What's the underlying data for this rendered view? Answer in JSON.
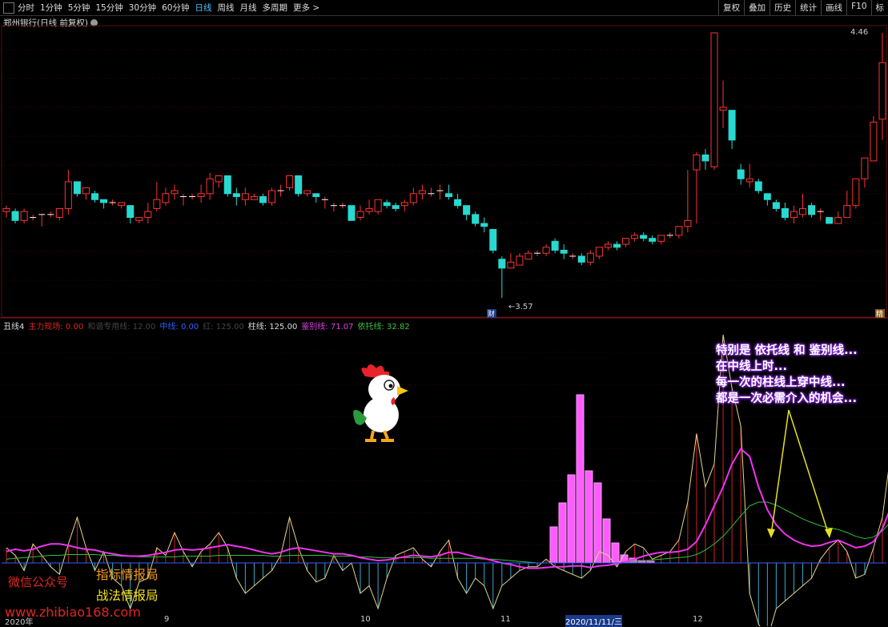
{
  "toolbar": {
    "items": [
      "分时",
      "1分钟",
      "5分钟",
      "15分钟",
      "30分钟",
      "60分钟",
      "日线",
      "周线",
      "月线",
      "多周期",
      "更多 >"
    ],
    "active_index": 6,
    "right_buttons": [
      "复权",
      "叠加",
      "历史",
      "统计",
      "画线",
      "F10",
      "标"
    ]
  },
  "stock_title": "郑州银行(日线 前复权)",
  "price_labels": {
    "high": "4.46",
    "low": "3.57"
  },
  "markers": {
    "cai": "财",
    "jing": "精"
  },
  "indicator_bar": [
    {
      "text": "丑线4",
      "color": "#dddddd"
    },
    {
      "text": "主力现场: 0.00",
      "color": "#e0261f"
    },
    {
      "text": "和谐专用线: 12.00",
      "color": "#444444"
    },
    {
      "text": "中线: 0.00",
      "color": "#3060ff"
    },
    {
      "text": "红: 125.00",
      "color": "#444444"
    },
    {
      "text": "柱线: 125.00",
      "color": "#dddddd"
    },
    {
      "text": "鉴别线: 71.07",
      "color": "#e040e0"
    },
    {
      "text": "依托线: 32.82",
      "color": "#40c040"
    }
  ],
  "annotation": [
    "特别是 依托线 和 鉴别线...",
    "在中线上时...",
    "每一次的柱线上穿中线...",
    "都是一次必需介入的机会..."
  ],
  "watermarks": {
    "wechat": "微信公众号",
    "brand1": "指标情报局",
    "brand2": "战法情报局",
    "url": "www.zhibiao168.com"
  },
  "x_axis": [
    "2020年",
    "9",
    "10",
    "11",
    "2020/11/11/三",
    "12"
  ],
  "chart_data": {
    "type": "candlestick",
    "high_label": 4.46,
    "low_label": 3.57,
    "candles": [
      {
        "o": 3.86,
        "h": 3.88,
        "c": 3.87,
        "l": 3.84
      },
      {
        "o": 3.86,
        "h": 3.87,
        "c": 3.83,
        "l": 3.82
      },
      {
        "o": 3.83,
        "h": 3.87,
        "c": 3.86,
        "l": 3.82
      },
      {
        "o": 3.84,
        "h": 3.85,
        "c": 3.84,
        "l": 3.83
      },
      {
        "o": 3.85,
        "h": 3.85,
        "c": 3.85,
        "l": 3.81
      },
      {
        "o": 3.85,
        "h": 3.86,
        "c": 3.85,
        "l": 3.84
      },
      {
        "o": 3.84,
        "h": 3.87,
        "c": 3.87,
        "l": 3.83
      },
      {
        "o": 3.87,
        "h": 4.0,
        "c": 3.96,
        "l": 3.85
      },
      {
        "o": 3.96,
        "h": 3.96,
        "c": 3.92,
        "l": 3.91
      },
      {
        "o": 3.92,
        "h": 3.94,
        "c": 3.94,
        "l": 3.9
      },
      {
        "o": 3.92,
        "h": 3.93,
        "c": 3.9,
        "l": 3.89
      },
      {
        "o": 3.9,
        "h": 3.9,
        "c": 3.89,
        "l": 3.87
      },
      {
        "o": 3.89,
        "h": 3.9,
        "c": 3.89,
        "l": 3.88
      },
      {
        "o": 3.88,
        "h": 3.88,
        "c": 3.89,
        "l": 3.87
      },
      {
        "o": 3.88,
        "h": 3.88,
        "c": 3.84,
        "l": 3.82
      },
      {
        "o": 3.83,
        "h": 3.84,
        "c": 3.84,
        "l": 3.82
      },
      {
        "o": 3.84,
        "h": 3.89,
        "c": 3.86,
        "l": 3.82
      },
      {
        "o": 3.87,
        "h": 3.96,
        "c": 3.9,
        "l": 3.86
      },
      {
        "o": 3.89,
        "h": 3.94,
        "c": 3.92,
        "l": 3.88
      },
      {
        "o": 3.92,
        "h": 3.95,
        "c": 3.93,
        "l": 3.9
      },
      {
        "o": 3.91,
        "h": 3.92,
        "c": 3.91,
        "l": 3.88
      },
      {
        "o": 3.91,
        "h": 3.92,
        "c": 3.91,
        "l": 3.9
      },
      {
        "o": 3.91,
        "h": 3.95,
        "c": 3.92,
        "l": 3.89
      },
      {
        "o": 3.92,
        "h": 3.99,
        "c": 3.97,
        "l": 3.9
      },
      {
        "o": 3.96,
        "h": 3.98,
        "c": 3.98,
        "l": 3.94
      },
      {
        "o": 3.98,
        "h": 3.98,
        "c": 3.92,
        "l": 3.91
      },
      {
        "o": 3.92,
        "h": 3.94,
        "c": 3.91,
        "l": 3.88
      },
      {
        "o": 3.9,
        "h": 3.94,
        "c": 3.92,
        "l": 3.88
      },
      {
        "o": 3.9,
        "h": 3.92,
        "c": 3.91,
        "l": 3.9
      },
      {
        "o": 3.91,
        "h": 3.92,
        "c": 3.89,
        "l": 3.88
      },
      {
        "o": 3.89,
        "h": 3.94,
        "c": 3.93,
        "l": 3.88
      },
      {
        "o": 3.93,
        "h": 3.95,
        "c": 3.93,
        "l": 3.91
      },
      {
        "o": 3.94,
        "h": 3.98,
        "c": 3.98,
        "l": 3.93
      },
      {
        "o": 3.98,
        "h": 3.98,
        "c": 3.92,
        "l": 3.91
      },
      {
        "o": 3.92,
        "h": 3.93,
        "c": 3.93,
        "l": 3.91
      },
      {
        "o": 3.92,
        "h": 3.92,
        "c": 3.91,
        "l": 3.89
      },
      {
        "o": 3.9,
        "h": 3.91,
        "c": 3.9,
        "l": 3.87
      },
      {
        "o": 3.88,
        "h": 3.89,
        "c": 3.88,
        "l": 3.86
      },
      {
        "o": 3.88,
        "h": 3.89,
        "c": 3.88,
        "l": 3.87
      },
      {
        "o": 3.88,
        "h": 3.88,
        "c": 3.83,
        "l": 3.83
      },
      {
        "o": 3.84,
        "h": 3.88,
        "c": 3.86,
        "l": 3.83
      },
      {
        "o": 3.86,
        "h": 3.9,
        "c": 3.87,
        "l": 3.85
      },
      {
        "o": 3.86,
        "h": 3.9,
        "c": 3.9,
        "l": 3.85
      },
      {
        "o": 3.89,
        "h": 3.9,
        "c": 3.88,
        "l": 3.87
      },
      {
        "o": 3.88,
        "h": 3.89,
        "c": 3.87,
        "l": 3.86
      },
      {
        "o": 3.88,
        "h": 3.9,
        "c": 3.89,
        "l": 3.86
      },
      {
        "o": 3.89,
        "h": 3.94,
        "c": 3.92,
        "l": 3.88
      },
      {
        "o": 3.92,
        "h": 3.95,
        "c": 3.93,
        "l": 3.9
      },
      {
        "o": 3.92,
        "h": 3.94,
        "c": 3.92,
        "l": 3.91
      },
      {
        "o": 3.93,
        "h": 3.95,
        "c": 3.93,
        "l": 3.9
      },
      {
        "o": 3.92,
        "h": 3.95,
        "c": 3.91,
        "l": 3.9
      },
      {
        "o": 3.9,
        "h": 3.92,
        "c": 3.88,
        "l": 3.87
      },
      {
        "o": 3.88,
        "h": 3.88,
        "c": 3.85,
        "l": 3.83
      },
      {
        "o": 3.85,
        "h": 3.86,
        "c": 3.82,
        "l": 3.81
      },
      {
        "o": 3.82,
        "h": 3.84,
        "c": 3.81,
        "l": 3.79
      },
      {
        "o": 3.8,
        "h": 3.8,
        "c": 3.73,
        "l": 3.72
      },
      {
        "o": 3.7,
        "h": 3.71,
        "c": 3.67,
        "l": 3.57
      },
      {
        "o": 3.67,
        "h": 3.72,
        "c": 3.69,
        "l": 3.67
      },
      {
        "o": 3.68,
        "h": 3.72,
        "c": 3.71,
        "l": 3.69
      },
      {
        "o": 3.7,
        "h": 3.73,
        "c": 3.72,
        "l": 3.7
      },
      {
        "o": 3.72,
        "h": 3.73,
        "c": 3.72,
        "l": 3.71
      },
      {
        "o": 3.72,
        "h": 3.75,
        "c": 3.74,
        "l": 3.71
      },
      {
        "o": 3.76,
        "h": 3.77,
        "c": 3.73,
        "l": 3.72
      },
      {
        "o": 3.73,
        "h": 3.75,
        "c": 3.72,
        "l": 3.7
      },
      {
        "o": 3.71,
        "h": 3.72,
        "c": 3.71,
        "l": 3.7
      },
      {
        "o": 3.71,
        "h": 3.72,
        "c": 3.69,
        "l": 3.68
      },
      {
        "o": 3.69,
        "h": 3.73,
        "c": 3.72,
        "l": 3.68
      },
      {
        "o": 3.71,
        "h": 3.74,
        "c": 3.74,
        "l": 3.7
      },
      {
        "o": 3.74,
        "h": 3.76,
        "c": 3.75,
        "l": 3.73
      },
      {
        "o": 3.75,
        "h": 3.76,
        "c": 3.74,
        "l": 3.73
      },
      {
        "o": 3.75,
        "h": 3.77,
        "c": 3.77,
        "l": 3.74
      },
      {
        "o": 3.77,
        "h": 3.79,
        "c": 3.78,
        "l": 3.76
      },
      {
        "o": 3.78,
        "h": 3.79,
        "c": 3.77,
        "l": 3.76
      },
      {
        "o": 3.77,
        "h": 3.78,
        "c": 3.76,
        "l": 3.75
      },
      {
        "o": 3.76,
        "h": 3.78,
        "c": 3.78,
        "l": 3.75
      },
      {
        "o": 3.78,
        "h": 3.79,
        "c": 3.78,
        "l": 3.77
      },
      {
        "o": 3.78,
        "h": 3.81,
        "c": 3.81,
        "l": 3.77
      },
      {
        "o": 3.81,
        "h": 4.0,
        "c": 3.83,
        "l": 3.79
      },
      {
        "o": 4.0,
        "h": 4.06,
        "c": 4.05,
        "l": 3.82
      },
      {
        "o": 4.05,
        "h": 4.07,
        "c": 4.03,
        "l": 4.0
      },
      {
        "o": 4.01,
        "h": 4.44,
        "c": 4.46,
        "l": 4.0
      },
      {
        "o": 4.2,
        "h": 4.3,
        "c": 4.21,
        "l": 4.14
      },
      {
        "o": 4.2,
        "h": 4.2,
        "c": 4.1,
        "l": 4.07
      },
      {
        "o": 4.0,
        "h": 4.02,
        "c": 3.97,
        "l": 3.95
      },
      {
        "o": 3.96,
        "h": 4.02,
        "c": 3.97,
        "l": 3.94
      },
      {
        "o": 3.96,
        "h": 3.97,
        "c": 3.93,
        "l": 3.92
      },
      {
        "o": 3.92,
        "h": 3.92,
        "c": 3.9,
        "l": 3.88
      },
      {
        "o": 3.89,
        "h": 3.9,
        "c": 3.87,
        "l": 3.86
      },
      {
        "o": 3.87,
        "h": 3.89,
        "c": 3.84,
        "l": 3.83
      },
      {
        "o": 3.84,
        "h": 3.88,
        "c": 3.86,
        "l": 3.82
      },
      {
        "o": 3.85,
        "h": 3.92,
        "c": 3.87,
        "l": 3.84
      },
      {
        "o": 3.88,
        "h": 3.89,
        "c": 3.85,
        "l": 3.84
      },
      {
        "o": 3.86,
        "h": 3.87,
        "c": 3.86,
        "l": 3.83
      },
      {
        "o": 3.84,
        "h": 3.84,
        "c": 3.82,
        "l": 3.82
      },
      {
        "o": 3.82,
        "h": 3.86,
        "c": 3.84,
        "l": 3.82
      },
      {
        "o": 3.84,
        "h": 3.93,
        "c": 3.88,
        "l": 3.84
      },
      {
        "o": 3.88,
        "h": 3.96,
        "c": 3.97,
        "l": 3.87
      },
      {
        "o": 3.97,
        "h": 4.04,
        "c": 4.04,
        "l": 3.94
      },
      {
        "o": 4.03,
        "h": 4.18,
        "c": 4.16,
        "l": 4.03
      },
      {
        "o": 4.17,
        "h": 4.46,
        "c": 4.36,
        "l": 4.1
      }
    ],
    "indicator": {
      "zhuxian": [
        20,
        10,
        -10,
        25,
        10,
        -5,
        -15,
        25,
        60,
        20,
        -10,
        15,
        -20,
        -30,
        -60,
        -25,
        -20,
        20,
        10,
        40,
        15,
        -5,
        15,
        25,
        40,
        20,
        -20,
        -40,
        -30,
        -20,
        -10,
        10,
        60,
        20,
        -10,
        -25,
        -20,
        10,
        -10,
        0,
        -40,
        -30,
        -60,
        -20,
        10,
        15,
        20,
        5,
        -5,
        15,
        30,
        -20,
        -40,
        -20,
        -30,
        -60,
        -30,
        -20,
        -10,
        -5,
        -5,
        5,
        -5,
        -10,
        -15,
        -20,
        -10,
        15,
        10,
        -5,
        15,
        25,
        20,
        5,
        10,
        15,
        30,
        80,
        170,
        100,
        130,
        300,
        230,
        180,
        -40,
        -80,
        -100,
        -60,
        -50,
        -40,
        -30,
        -20,
        5,
        20,
        30,
        15,
        -20,
        -15,
        20,
        60,
        150,
        200,
        280
      ],
      "jianbie": [
        15,
        18,
        16,
        18,
        22,
        25,
        25,
        23,
        20,
        18,
        17,
        14,
        12,
        10,
        9,
        9,
        10,
        12,
        14,
        17,
        18,
        17,
        18,
        20,
        22,
        24,
        22,
        20,
        17,
        14,
        12,
        14,
        18,
        20,
        18,
        16,
        14,
        12,
        12,
        10,
        7,
        5,
        3,
        4,
        6,
        8,
        10,
        9,
        8,
        10,
        14,
        14,
        11,
        8,
        6,
        3,
        0,
        -2,
        -5,
        -7,
        -7,
        -6,
        -5,
        -5,
        -4,
        -4,
        -6,
        -4,
        -3,
        -1,
        2,
        5,
        9,
        12,
        14,
        14,
        15,
        18,
        28,
        50,
        75,
        100,
        130,
        150,
        140,
        100,
        70,
        50,
        38,
        30,
        25,
        22,
        23,
        27,
        30,
        25,
        20,
        22,
        28,
        45,
        75,
        110,
        155
      ],
      "yituo": [
        5,
        6,
        7,
        8,
        9,
        10,
        10,
        11,
        11,
        11,
        11,
        10,
        10,
        9,
        9,
        8,
        8,
        8,
        8,
        8,
        9,
        9,
        9,
        9,
        10,
        10,
        10,
        10,
        10,
        10,
        9,
        9,
        10,
        10,
        10,
        10,
        10,
        9,
        9,
        9,
        8,
        8,
        7,
        7,
        7,
        7,
        7,
        7,
        6,
        6,
        6,
        6,
        6,
        6,
        5,
        5,
        4,
        3,
        2,
        1,
        0,
        0,
        0,
        0,
        0,
        0,
        0,
        0,
        0,
        0,
        1,
        2,
        3,
        4,
        5,
        6,
        7,
        8,
        11,
        17,
        25,
        35,
        48,
        62,
        75,
        80,
        80,
        76,
        70,
        64,
        58,
        53,
        49,
        46,
        44,
        40,
        35,
        32,
        34,
        42,
        55,
        70,
        92
      ],
      "magenta_bars": [
        0,
        0,
        0,
        0,
        0,
        0,
        0,
        0,
        0,
        0,
        0,
        0,
        0,
        0,
        0,
        0,
        0,
        0,
        0,
        0,
        0,
        0,
        0,
        0,
        0,
        0,
        0,
        0,
        0,
        0,
        0,
        0,
        0,
        0,
        0,
        0,
        0,
        0,
        0,
        0,
        0,
        0,
        0,
        0,
        0,
        0,
        0,
        0,
        0,
        0,
        0,
        0,
        0,
        0,
        0,
        0,
        0,
        0,
        0,
        0,
        0,
        0,
        0,
        0,
        0,
        0,
        0,
        0,
        0,
        0,
        0,
        0,
        0,
        0,
        0,
        0,
        0,
        0,
        0,
        0,
        0,
        0,
        0,
        0,
        0,
        0,
        0,
        0,
        0,
        0,
        0,
        0,
        0,
        0,
        0,
        0,
        0,
        0,
        0,
        0,
        0,
        0,
        0
      ]
    }
  }
}
